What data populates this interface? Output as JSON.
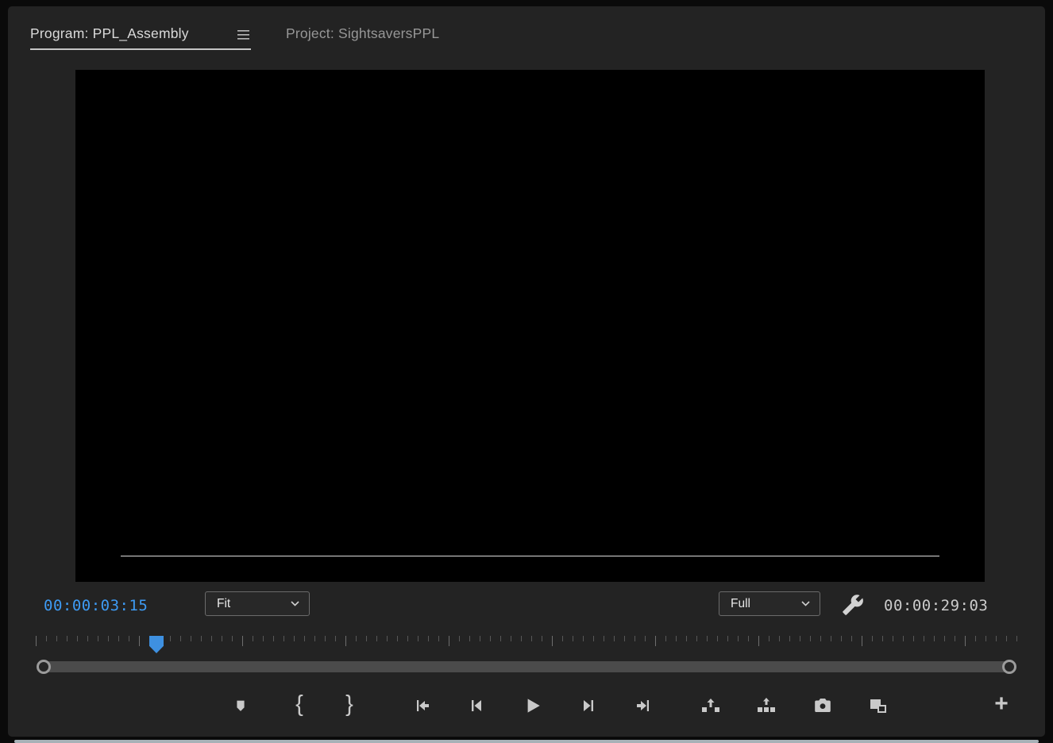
{
  "tab_bar": {
    "tabs": [
      {
        "label": "Program: PPL_Assembly",
        "active": true
      },
      {
        "label": "Project: SightsaversPPL",
        "active": false
      }
    ]
  },
  "monitor": {
    "current_timecode": "00:00:03:15",
    "zoom_level": "Fit",
    "playback_resolution": "Full",
    "sequence_duration": "00:00:29:03"
  },
  "transport": {
    "mark_in_glyph": "{",
    "mark_out_glyph": "}",
    "add_button_glyph": "+",
    "buttons": [
      "add-marker",
      "mark-in",
      "mark-out",
      "go-to-in",
      "step-back",
      "play",
      "step-forward",
      "go-to-out",
      "lift",
      "extract",
      "export-frame",
      "comparison-view",
      "button-editor"
    ]
  },
  "icons": {
    "panel_menu": "hamburger-icon",
    "settings": "wrench-icon",
    "dropdown": "chevron-down-icon"
  },
  "colors": {
    "timecode_blue": "#3E9BF4",
    "playhead_blue": "#3E90E0",
    "icon_gray": "#C9C9C9",
    "panel_background": "#232323"
  }
}
